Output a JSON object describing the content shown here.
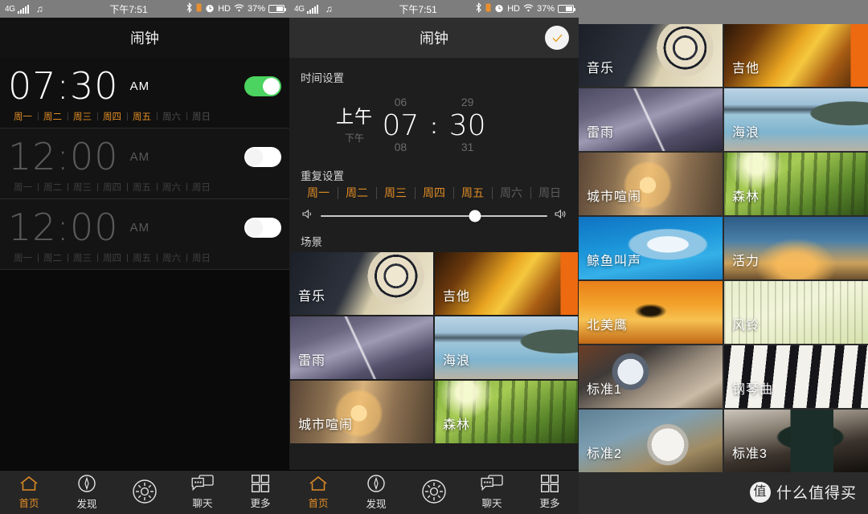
{
  "status_bar": {
    "network": "4G",
    "music_icon": "music-note-icon",
    "time": "下午7:51",
    "bluetooth_icon": "bluetooth-icon",
    "sim_icon": "sim-icon",
    "alarm_icon": "alarm-icon",
    "hd": "HD",
    "wifi_icon": "wifi-icon",
    "battery": "37%"
  },
  "panel_left": {
    "title": "闹钟",
    "alarms": [
      {
        "time": "07:30",
        "ampm": "AM",
        "enabled": true,
        "days": [
          {
            "label": "周一",
            "active": true
          },
          {
            "label": "周二",
            "active": true
          },
          {
            "label": "周三",
            "active": true
          },
          {
            "label": "周四",
            "active": true
          },
          {
            "label": "周五",
            "active": true
          },
          {
            "label": "周六",
            "active": false
          },
          {
            "label": "周日",
            "active": false
          }
        ]
      },
      {
        "time": "12:00",
        "ampm": "AM",
        "enabled": false,
        "days": [
          {
            "label": "周一",
            "active": false
          },
          {
            "label": "周二",
            "active": false
          },
          {
            "label": "周三",
            "active": false
          },
          {
            "label": "周四",
            "active": false
          },
          {
            "label": "周五",
            "active": false
          },
          {
            "label": "周六",
            "active": false
          },
          {
            "label": "周日",
            "active": false
          }
        ]
      },
      {
        "time": "12:00",
        "ampm": "AM",
        "enabled": false,
        "days": [
          {
            "label": "周一",
            "active": false
          },
          {
            "label": "周二",
            "active": false
          },
          {
            "label": "周三",
            "active": false
          },
          {
            "label": "周四",
            "active": false
          },
          {
            "label": "周五",
            "active": false
          },
          {
            "label": "周六",
            "active": false
          },
          {
            "label": "周日",
            "active": false
          }
        ]
      }
    ]
  },
  "panel_middle": {
    "title": "闹钟",
    "confirm_icon": "check-icon",
    "time_setting_label": "时间设置",
    "picker": {
      "ampm_selected": "上午",
      "ampm_other": "下午",
      "hour_prev": "06",
      "hour": "07",
      "hour_next": "08",
      "separator": ":",
      "minute_prev": "29",
      "minute": "30",
      "minute_next": "31"
    },
    "repeat_label": "重复设置",
    "repeat_days": [
      {
        "label": "周一",
        "active": true
      },
      {
        "label": "周二",
        "active": true
      },
      {
        "label": "周三",
        "active": true
      },
      {
        "label": "周四",
        "active": true
      },
      {
        "label": "周五",
        "active": true
      },
      {
        "label": "周六",
        "active": false
      },
      {
        "label": "周日",
        "active": false
      }
    ],
    "volume": {
      "min_icon": "volume-low-icon",
      "max_icon": "volume-high-icon",
      "value_percent": 68
    },
    "scene_label": "场景",
    "scenes": [
      {
        "label": "音乐",
        "art": "vinyl-record"
      },
      {
        "label": "吉他",
        "art": "guitar"
      },
      {
        "label": "雷雨",
        "art": "thunderstorm"
      },
      {
        "label": "海浪",
        "art": "ocean-waves"
      },
      {
        "label": "城市喧闹",
        "art": "city-street"
      },
      {
        "label": "森林",
        "art": "forest"
      }
    ]
  },
  "panel_right": {
    "scenes": [
      {
        "label": "音乐",
        "art": "vinyl-record"
      },
      {
        "label": "吉他",
        "art": "guitar"
      },
      {
        "label": "雷雨",
        "art": "thunderstorm"
      },
      {
        "label": "海浪",
        "art": "ocean-waves"
      },
      {
        "label": "城市喧闹",
        "art": "city-street"
      },
      {
        "label": "森林",
        "art": "forest"
      },
      {
        "label": "鲸鱼叫声",
        "art": "whale"
      },
      {
        "label": "活力",
        "art": "vitality"
      },
      {
        "label": "北美鹰",
        "art": "eagle"
      },
      {
        "label": "风铃",
        "art": "wind-chime"
      },
      {
        "label": "标准1",
        "art": "desk-clock"
      },
      {
        "label": "钢琴曲",
        "art": "piano"
      },
      {
        "label": "标准2",
        "art": "twin-bell-clock"
      },
      {
        "label": "标准3",
        "art": "digital-clock"
      }
    ],
    "watermark": {
      "badge": "值",
      "text": "什么值得买"
    }
  },
  "nav_bar": {
    "items": [
      {
        "label": "首页",
        "icon": "home-icon",
        "active": true
      },
      {
        "label": "发现",
        "icon": "compass-icon",
        "active": false
      },
      {
        "label": "",
        "icon": "sun-icon",
        "active": false
      },
      {
        "label": "聊天",
        "icon": "chat-icon",
        "active": false
      },
      {
        "label": "更多",
        "icon": "grid-icon",
        "active": false
      }
    ]
  },
  "colors": {
    "accent": "#e08c25",
    "toggle_on": "#4bd45f",
    "statusbar_bg": "#7d7d7d",
    "panel_bg": "#1e1e1e"
  }
}
